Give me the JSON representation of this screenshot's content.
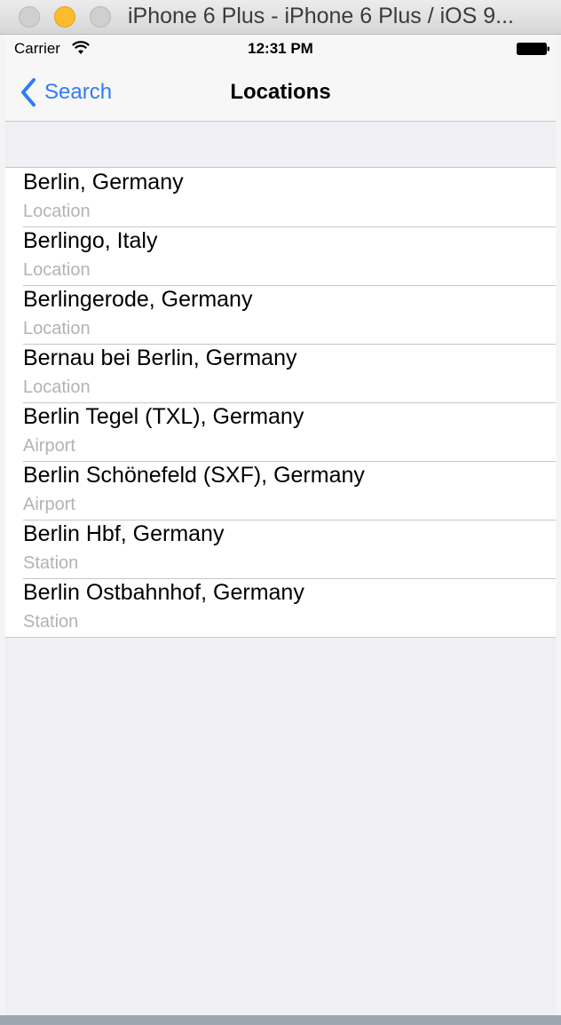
{
  "window": {
    "title": "iPhone 6 Plus - iPhone 6 Plus / iOS 9..."
  },
  "status_bar": {
    "carrier": "Carrier",
    "time": "12:31 PM"
  },
  "nav": {
    "back_label": "Search",
    "title": "Locations"
  },
  "locations": [
    {
      "name": "Berlin, Germany",
      "type": "Location"
    },
    {
      "name": "Berlingo, Italy",
      "type": "Location"
    },
    {
      "name": "Berlingerode, Germany",
      "type": "Location"
    },
    {
      "name": "Bernau bei Berlin, Germany",
      "type": "Location"
    },
    {
      "name": "Berlin Tegel (TXL), Germany",
      "type": "Airport"
    },
    {
      "name": "Berlin Schönefeld (SXF), Germany",
      "type": "Airport"
    },
    {
      "name": "Berlin Hbf, Germany",
      "type": "Station"
    },
    {
      "name": "Berlin Ostbahnhof, Germany",
      "type": "Station"
    }
  ],
  "colors": {
    "tint": "#2f7cf6",
    "subtitle": "#b3b3b3",
    "separator": "#c8c7cc",
    "grouped_background": "#efeff4"
  },
  "icons": {
    "back": "chevron-left-icon",
    "wifi": "wifi-icon",
    "battery": "battery-icon"
  }
}
